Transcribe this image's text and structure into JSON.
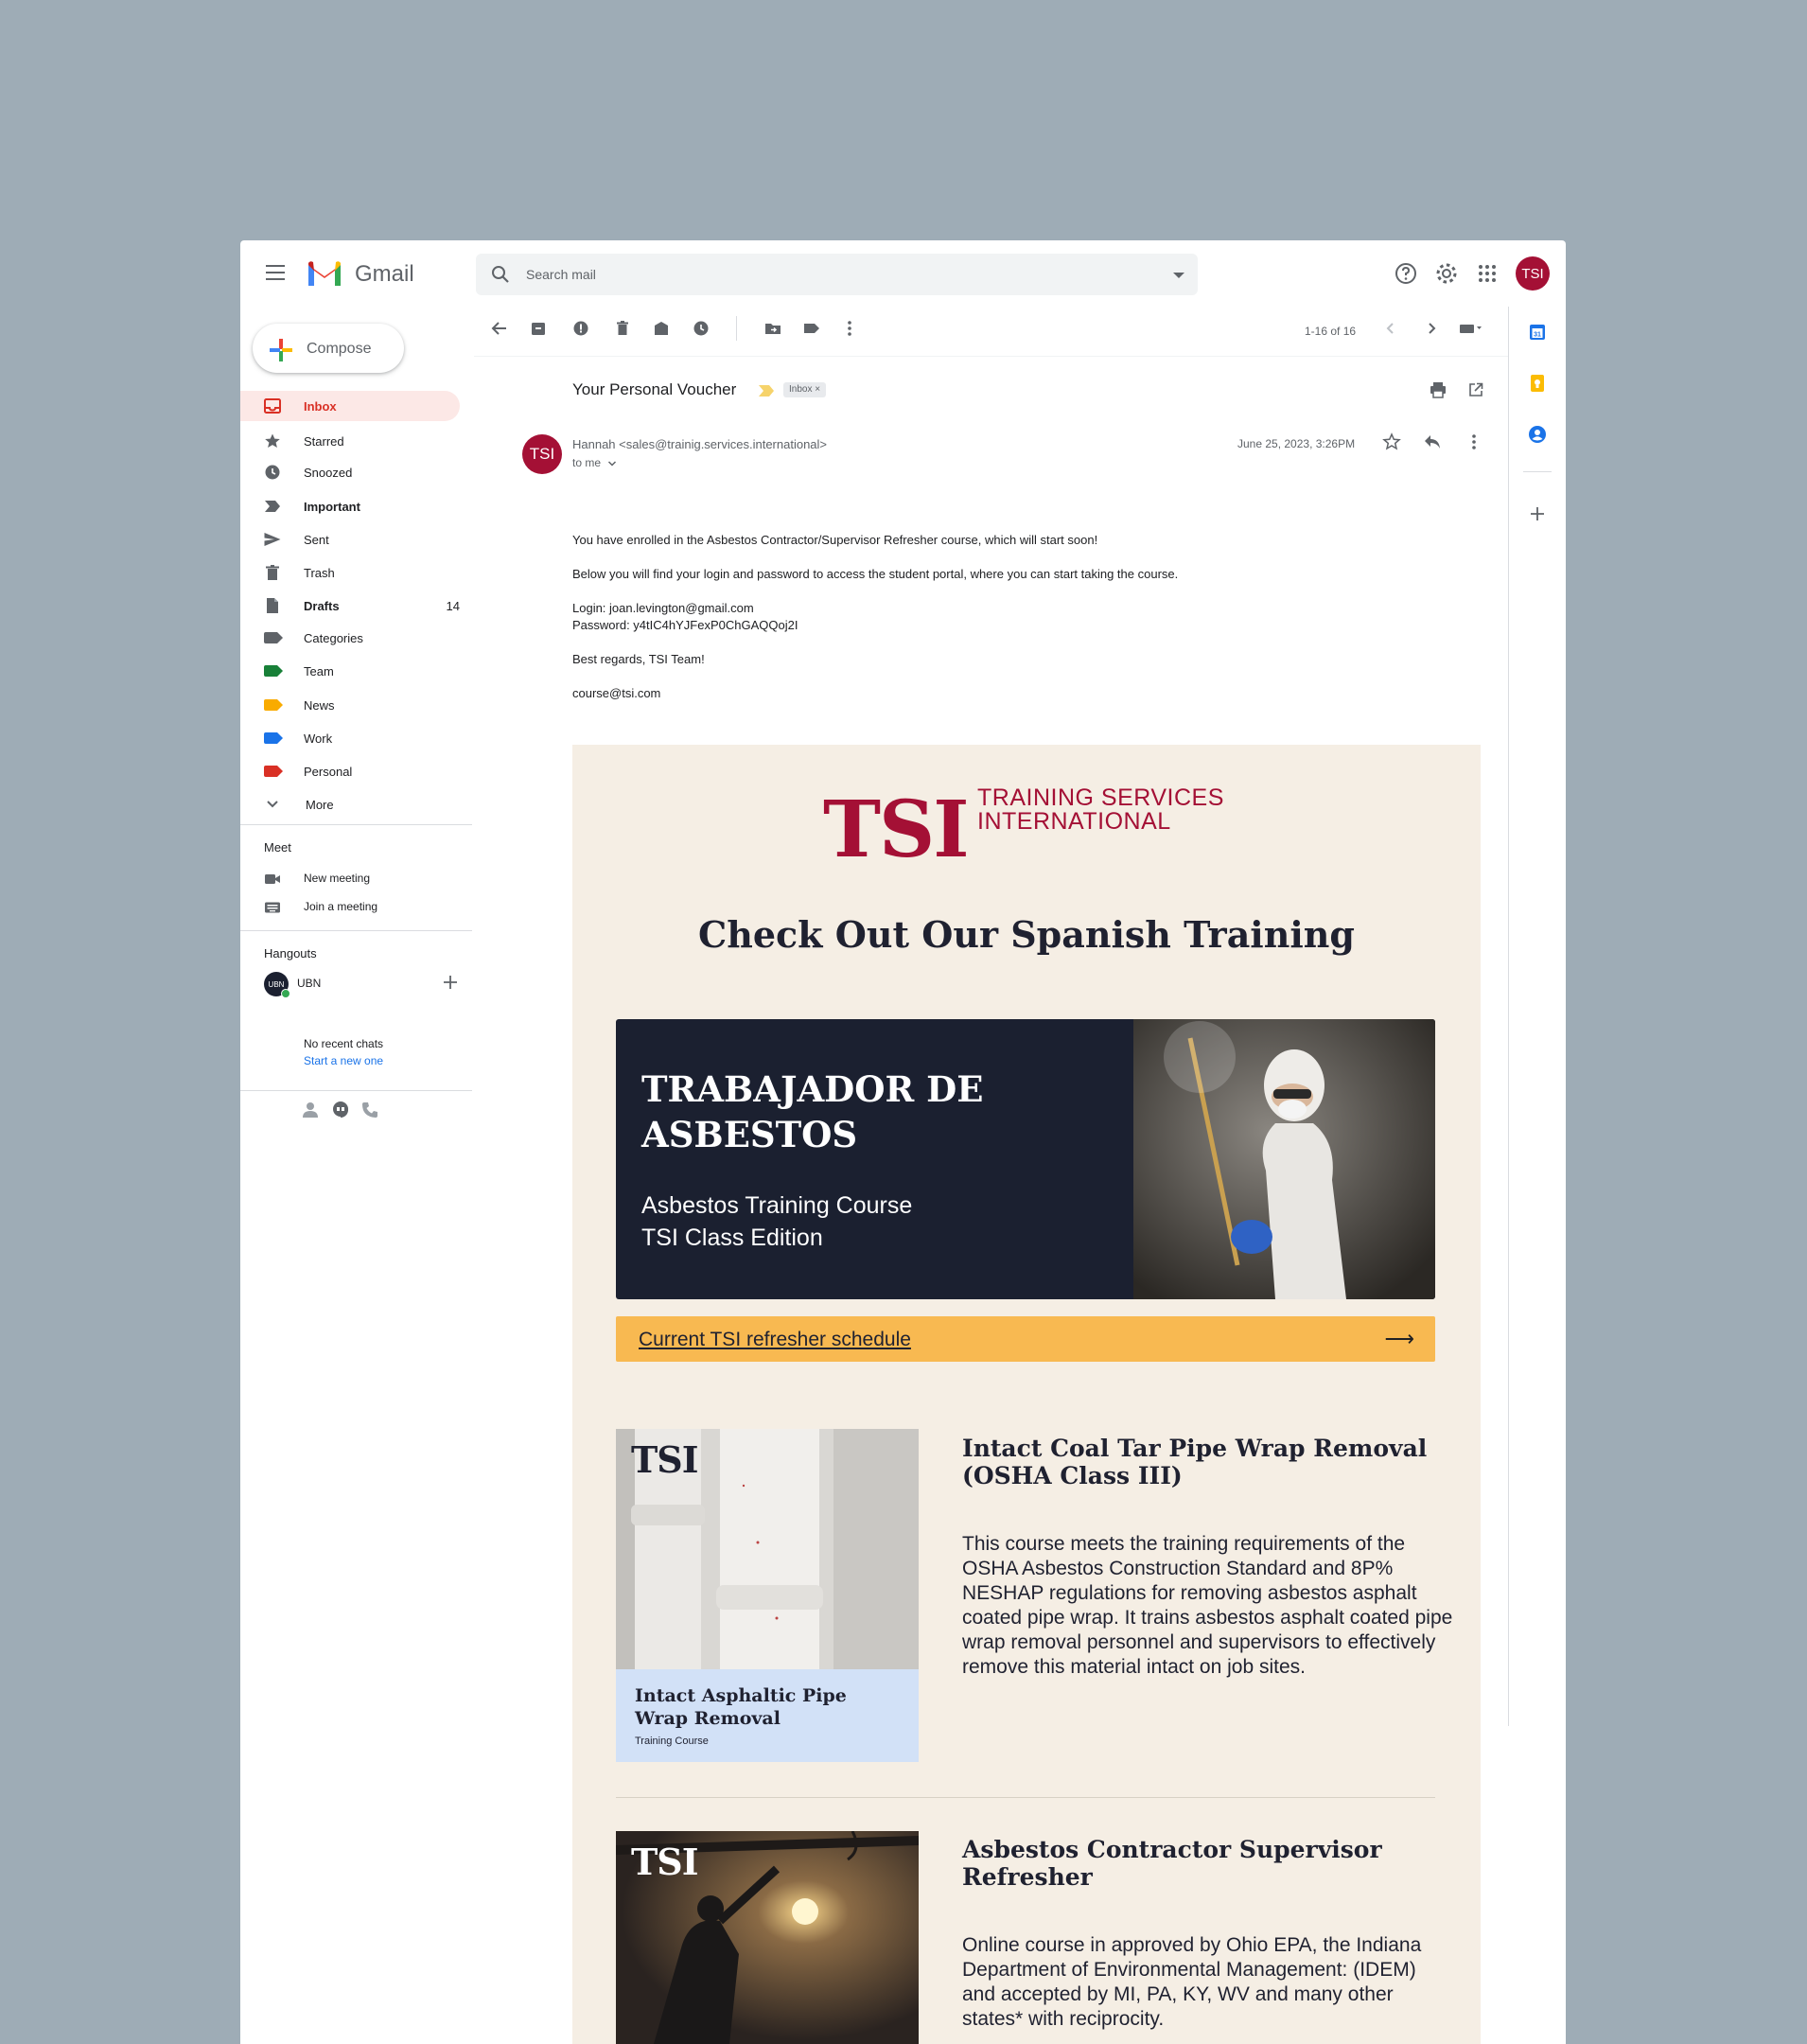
{
  "app": {
    "name": "Gmail"
  },
  "search": {
    "placeholder": "Search mail"
  },
  "account": {
    "initials": "TSI"
  },
  "compose": {
    "label": "Compose"
  },
  "sidebar": {
    "items": [
      {
        "label": "Inbox"
      },
      {
        "label": "Starred"
      },
      {
        "label": "Snoozed"
      },
      {
        "label": "Important"
      },
      {
        "label": "Sent"
      },
      {
        "label": "Trash"
      },
      {
        "label": "Drafts",
        "count": "14"
      },
      {
        "label": "Categories"
      },
      {
        "label": "Team"
      },
      {
        "label": "News"
      },
      {
        "label": "Work"
      },
      {
        "label": "Personal"
      },
      {
        "label": "More"
      }
    ],
    "label_colors": {
      "team": "#188038",
      "news": "#f9ab00",
      "work": "#1a73e8",
      "personal": "#d93025"
    },
    "meet": {
      "title": "Meet",
      "new_meeting": "New meeting",
      "join_meeting": "Join a meeting"
    },
    "hangouts": {
      "title": "Hangouts",
      "user": "UBN",
      "user_initials": "UBN",
      "no_chats": "No recent chats",
      "start_new": "Start a new one"
    }
  },
  "toolbar": {
    "pager": "1-16 of 16"
  },
  "message": {
    "subject": "Your Personal Voucher",
    "label_chip": "Inbox",
    "chip_close": "×",
    "sender_initials": "TSI",
    "sender": "Hannah <sales@trainig.services.international>",
    "to": "to me",
    "date": "June 25, 2023, 3:26PM",
    "body": {
      "line1": "You have enrolled in the Asbestos Contractor/Supervisor Refresher course, which will start soon!",
      "line2": "Below you will find your login and password to access the student portal, where you can start taking the course.",
      "login": "Login: joan.levington@gmail.com",
      "password": "Password: y4tIC4hYJFexP0ChGAQQoj2I",
      "regards": "Best regards, TSI Team!",
      "email": "course@tsi.com"
    }
  },
  "newsletter": {
    "logo_mark": "TSI",
    "logo_line1": "TRAINING SERVICES",
    "logo_line2": "INTERNATIONAL",
    "headline": "Check Out Our Spanish Training",
    "hero": {
      "title_line1": "TRABAJADOR DE",
      "title_line2": "ASBESTOS",
      "sub_line1": "Asbestos Training Course",
      "sub_line2": "TSI Class Edition"
    },
    "cta": {
      "label": "Current TSI refresher schedule",
      "arrow": "⟶"
    },
    "courses": [
      {
        "card_mark": "TSI",
        "card_title_line1": "Intact Asphaltic Pipe",
        "card_title_line2": "Wrap Removal",
        "card_subtitle": "Training Course",
        "title_line1": "Intact Coal Tar Pipe Wrap Removal",
        "title_line2": "(OSHA Class III)",
        "description": "This course meets the training requirements of the OSHA Asbestos Construction Standard and 8P% NESHAP regulations for removing asbestos asphalt coated pipe wrap. It trains asbestos asphalt coated pipe wrap removal personnel and supervisors to effectively remove this material intact on job sites."
      },
      {
        "card_mark": "TSI",
        "title_line1": "Asbestos Contractor Supervisor",
        "title_line2": "Refresher",
        "description": "Online course in approved by Ohio EPA, the Indiana Department of Environmental Management: (IDEM) and accepted by MI, PA, KY, WV and many other states* with reciprocity."
      }
    ]
  },
  "colors": {
    "brand": "#a41035",
    "cta": "#f8b951",
    "newsletter_bg": "#f5eee4",
    "hero_bg": "#1b2030"
  }
}
